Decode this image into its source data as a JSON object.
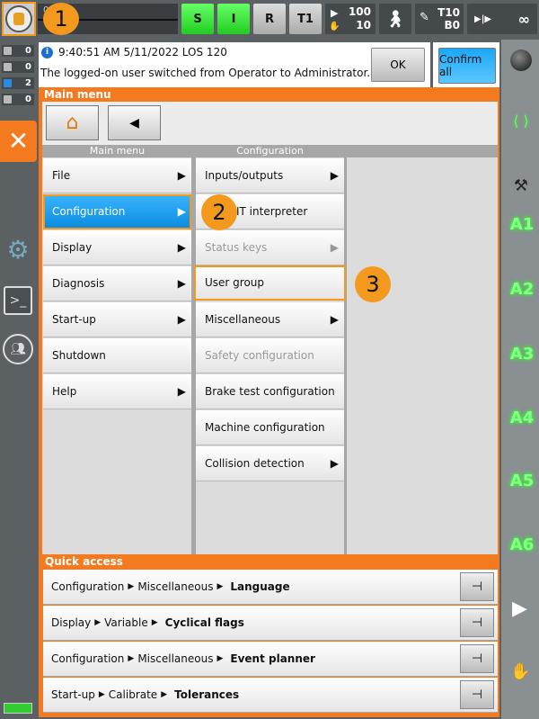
{
  "topbar": {
    "progress_value": "0",
    "modes": [
      "S",
      "I",
      "R",
      "T1"
    ],
    "override_prog": "100",
    "override_jog": "10",
    "tool": "T10",
    "base": "B0",
    "speed": "∞"
  },
  "badges": [
    "1",
    "2",
    "3"
  ],
  "counters": [
    "0",
    "0",
    "2",
    "0"
  ],
  "message": {
    "header": "9:40:51 AM 5/11/2022 LOS 120",
    "text": "The logged-on user switched from Operator to Administrator.",
    "ok": "OK",
    "confirm_all": "Confirm all"
  },
  "main_menu": {
    "title": "Main menu",
    "col1_header": "Main menu",
    "col2_header": "Configuration",
    "items": [
      {
        "label": "File",
        "arrow": true
      },
      {
        "label": "Configuration",
        "arrow": true
      },
      {
        "label": "Display",
        "arrow": true
      },
      {
        "label": "Diagnosis",
        "arrow": true
      },
      {
        "label": "Start-up",
        "arrow": true
      },
      {
        "label": "Shutdown",
        "arrow": false
      },
      {
        "label": "Help",
        "arrow": true
      }
    ],
    "sub_items": [
      {
        "label": "Inputs/outputs",
        "arrow": true
      },
      {
        "label": "SUBMIT interpreter",
        "visible": "T interpreter"
      },
      {
        "label": "Status keys",
        "arrow": true,
        "disabled": true
      },
      {
        "label": "User group"
      },
      {
        "label": "Miscellaneous",
        "arrow": true
      },
      {
        "label": "Safety configuration",
        "disabled": true
      },
      {
        "label": "Brake test configuration"
      },
      {
        "label": "Machine configuration"
      },
      {
        "label": "Collision detection",
        "arrow": true
      }
    ]
  },
  "quick_access": {
    "title": "Quick access",
    "rows": [
      {
        "path": [
          "Configuration",
          "Miscellaneous"
        ],
        "target": "Language"
      },
      {
        "path": [
          "Display",
          "Variable"
        ],
        "target": "Cyclical flags"
      },
      {
        "path": [
          "Configuration",
          "Miscellaneous"
        ],
        "target": "Event planner"
      },
      {
        "path": [
          "Start-up",
          "Calibrate"
        ],
        "target": "Tolerances"
      }
    ]
  },
  "axes": [
    "A1",
    "A2",
    "A3",
    "A4",
    "A5",
    "A6"
  ],
  "colors": {
    "accent": "#f47a20",
    "selected": "#0a8be0",
    "active_green": "#33dd33",
    "annotation": "#f39a1e"
  }
}
